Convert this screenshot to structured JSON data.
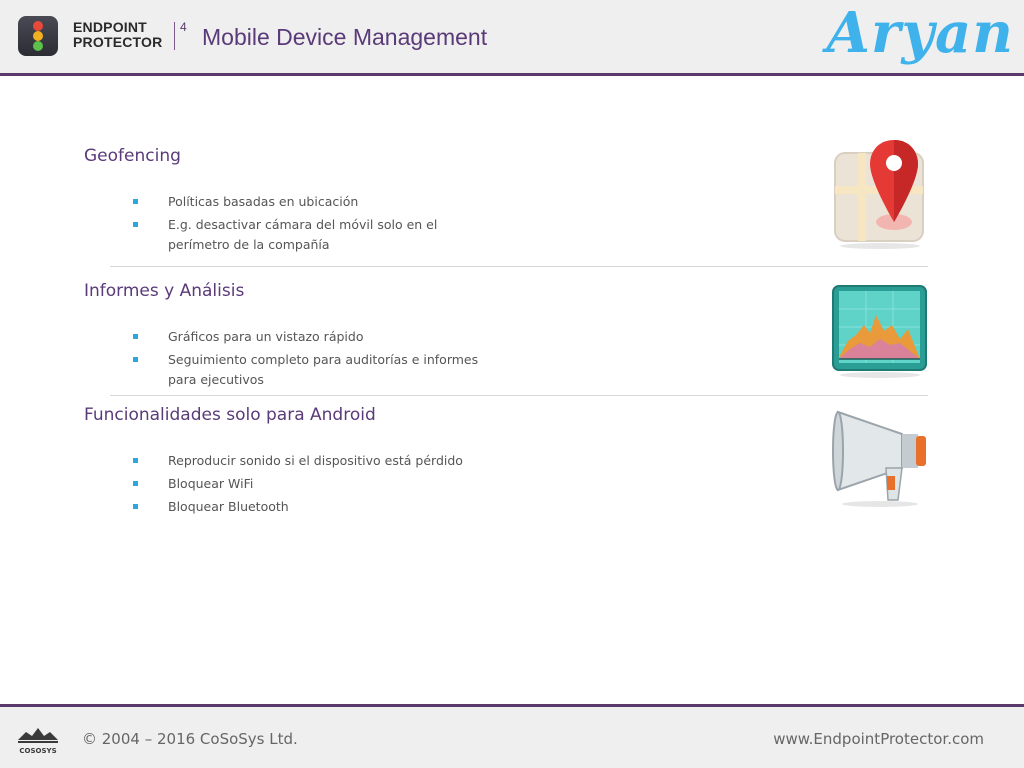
{
  "header": {
    "brand_line1": "ENDPOINT",
    "brand_line2": "PROTECTOR",
    "version": "4",
    "title": "Mobile Device Management",
    "signature": "Aryan"
  },
  "sections": [
    {
      "title": "Geofencing",
      "icon": "map-pin-icon",
      "bullets": [
        "Políticas basadas en ubicación",
        "E.g. desactivar cámara del móvil solo en el perímetro de la compañía"
      ]
    },
    {
      "title": "Informes y Análisis",
      "icon": "chart-screen-icon",
      "bullets": [
        "Gráficos para un vistazo rápido",
        "Seguimiento completo para auditorías e informes para ejecutivos"
      ]
    },
    {
      "title": "Funcionalidades solo para Android",
      "icon": "megaphone-icon",
      "bullets": [
        "Reproducir sonido si el dispositivo está pérdido",
        "Bloquear WiFi",
        "Bloquear Bluetooth"
      ]
    }
  ],
  "footer": {
    "logo_text": "COSOSYS",
    "copyright": "© 2004 – 2016 CoSoSys Ltd.",
    "website": "www.EndpointProtector.com"
  },
  "colors": {
    "accent_purple": "#5a3a78",
    "bullet_blue": "#2aa7de",
    "signature_blue": "#3fb2ec"
  }
}
